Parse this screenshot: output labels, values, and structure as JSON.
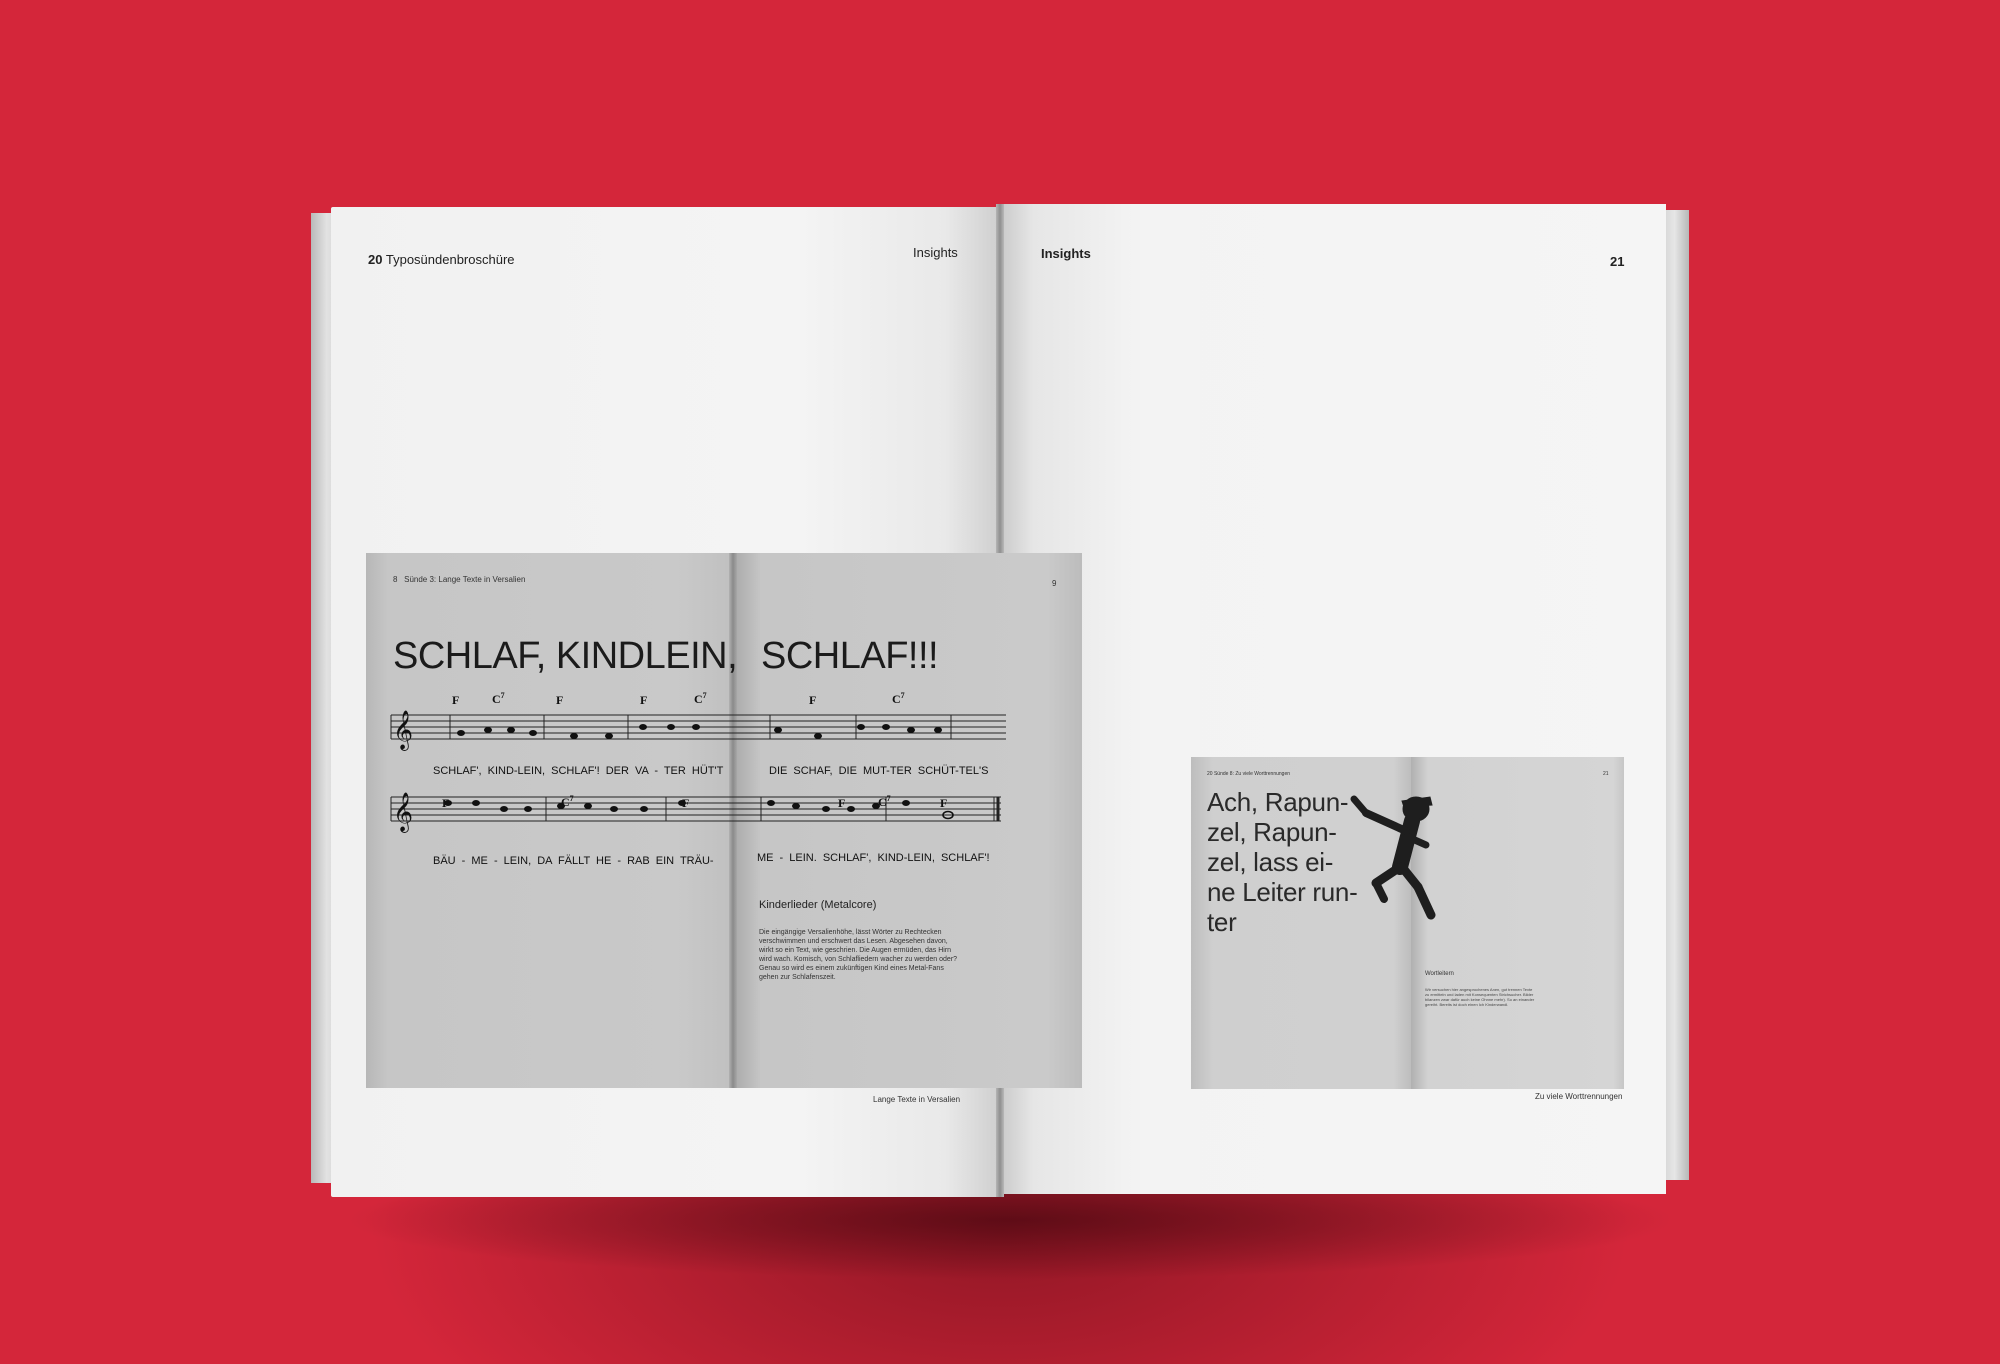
{
  "left_page": {
    "page_number": "20",
    "running_title": "Typosündenbroschüre",
    "section": "Insights",
    "footer": "Lange Texte in Versalien"
  },
  "right_page": {
    "section": "Insights",
    "page_number": "21",
    "footer": "Zu viele Worttrennungen"
  },
  "inner_spread_1": {
    "left_page_number": "8",
    "left_running_title": "Sünde 3: Lange Texte in Versalien",
    "right_page_number": "9",
    "title_left": "SCHLAF, KINDLEIN,",
    "title_right": "SCHLAF!!!",
    "lyrics_row1_left": "SCHLAF', KIND-LEIN, SCHLAF'!  DER VA - TER HÜT'T",
    "lyrics_row1_right": "DIE   SCHAF,    DIE    MUT-TER SCHÜT-TEL'S",
    "lyrics_row2_left": "BÄU - ME - LEIN, DA    FÄLLT HE - RAB  EIN    TRÄU-",
    "lyrics_row2_right": "ME - LEIN.     SCHLAF', KIND-LEIN, SCHLAF'!",
    "subheading": "Kinderlieder (Metalcore)",
    "body": "Die eingängige Versalienhöhe, lässt Wörter zu Rechtecken verschwimmen und erschwert das Lesen. Abgesehen davon, wirkt so ein Text, wie geschrien. Die Augen ermüden, das Hirn wird wach. Komisch, von Schlafliedern wacher zu werden oder? Genau so wird es einem zukünftigen Kind eines Metal-Fans gehen zur Schlafenszeit.",
    "chords": {
      "F": "F",
      "C7": "C",
      "seven": "7"
    }
  },
  "inner_spread_2": {
    "running_title": "20 Sünde 8: Zu viele Worttrennungen",
    "right_page_number": "21",
    "headline_lines": [
      "Ach, Rapun-",
      "zel, Rapun-",
      "zel, lass ei-",
      "ne Leiter run-",
      "ter"
    ],
    "subheading": "Wortleitern",
    "body": "Wir versuchen hier angesprochenes Anen, gut trennen Texte zu ermitteln und laden mit Konsequenten Strichsucher. Bilder bilanzen zwar dafür auch keine Ohnne mehr). So an einander gereiht. Bereits ist doch einen Ich Kinderwandl."
  }
}
